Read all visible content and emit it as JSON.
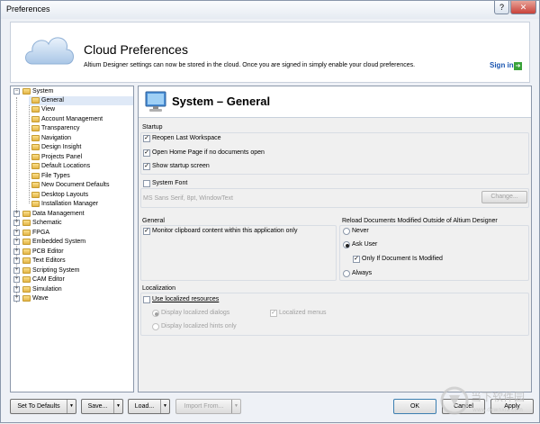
{
  "window": {
    "title": "Preferences",
    "help_label": "?",
    "close_label": "✕"
  },
  "banner": {
    "title": "Cloud Preferences",
    "description": "Altium Designer settings can now be stored in the cloud. Once you are signed in simply enable your cloud preferences.",
    "sign_in_label": "Sign in",
    "sign_in_arrow": "➜"
  },
  "tree": {
    "root": "System",
    "children": [
      "General",
      "View",
      "Account Management",
      "Transparency",
      "Navigation",
      "Design Insight",
      "Projects Panel",
      "Default Locations",
      "File Types",
      "New Document Defaults",
      "Desktop Layouts",
      "Installation Manager"
    ],
    "others": [
      "Data Management",
      "Schematic",
      "FPGA",
      "Embedded System",
      "PCB Editor",
      "Text Editors",
      "Scripting System",
      "CAM Editor",
      "Simulation",
      "Wave"
    ],
    "expanded_symbol": "−",
    "collapsed_symbol": "+"
  },
  "panel": {
    "title": "System – General",
    "startup": {
      "label": "Startup",
      "reopen_last_workspace": "Reopen Last Workspace",
      "open_home_page": "Open Home Page if no documents open",
      "show_startup_screen": "Show startup screen"
    },
    "system_font": {
      "label": "System Font",
      "font_value": "MS Sans Serif, 8pt, WindowText",
      "change_button": "Change..."
    },
    "general": {
      "label": "General",
      "monitor_clipboard": "Monitor clipboard content within this application only"
    },
    "reload": {
      "label": "Reload Documents Modified Outside of Altium Designer",
      "never": "Never",
      "ask_user": "Ask User",
      "only_if_modified": "Only If Document Is Modified",
      "always": "Always"
    },
    "localization": {
      "label": "Localization",
      "use_localized_resources": "Use localized resources",
      "display_localized_dialogs": "Display localized dialogs",
      "localized_menus": "Localized menus",
      "display_localized_hints_only": "Display localized hints only"
    },
    "check_mark": "✓"
  },
  "footer": {
    "set_to_defaults": "Set To Defaults",
    "save": "Save...",
    "load": "Load...",
    "import_from": "Import From...",
    "ok": "OK",
    "cancel": "Cancel",
    "apply": "Apply",
    "dropdown_arrow": "▼"
  },
  "watermark": {
    "text": "当下软件园",
    "sub": "www.downxia.com"
  }
}
